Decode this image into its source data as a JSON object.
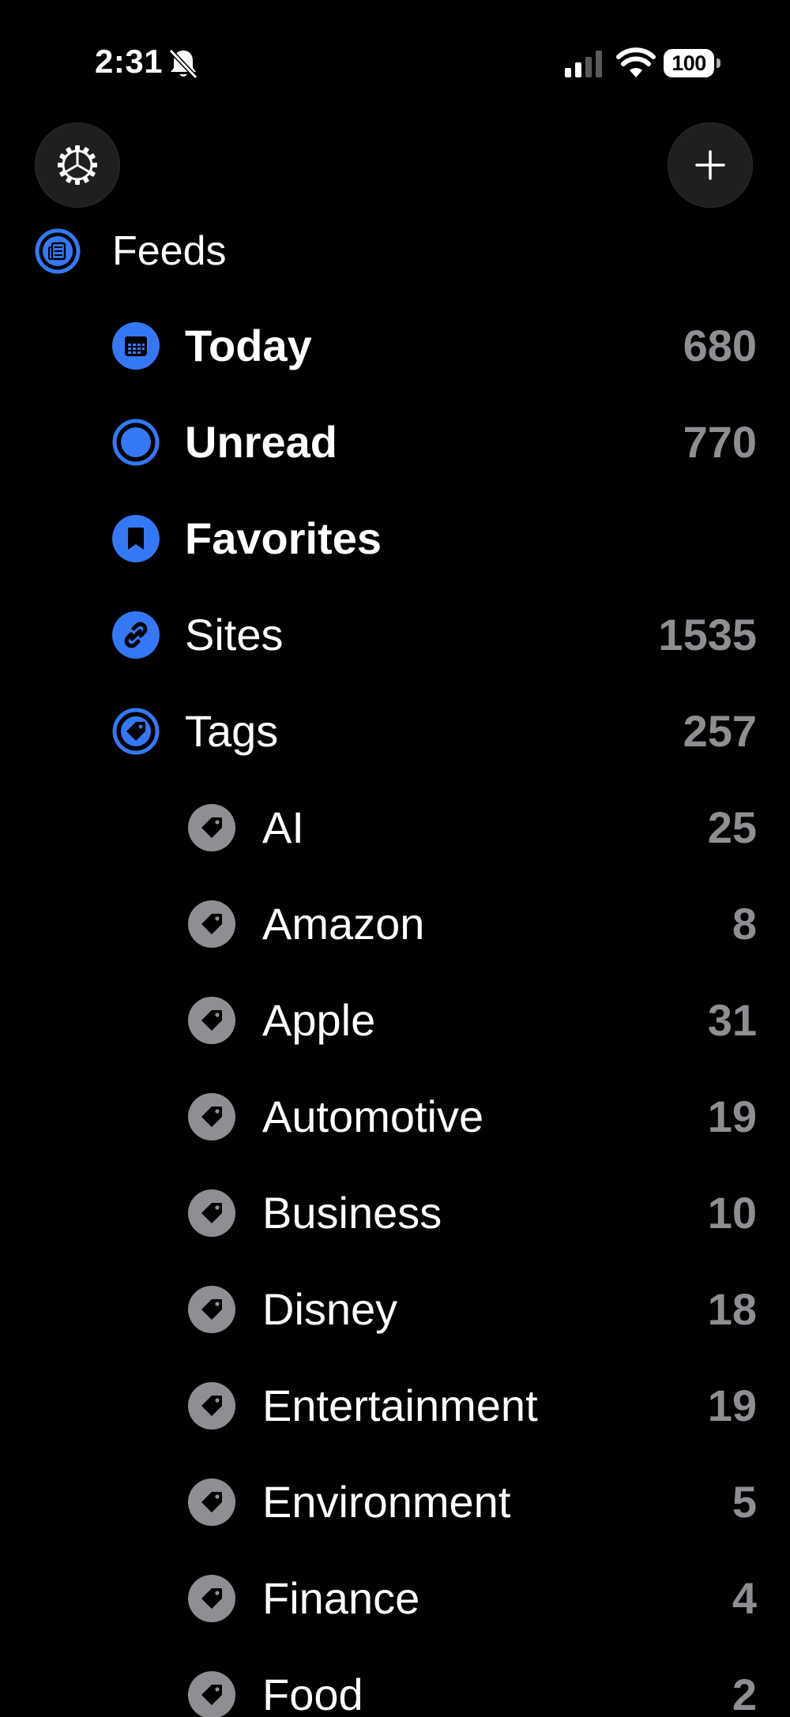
{
  "status_bar": {
    "time": "2:31",
    "battery": "100"
  },
  "colors": {
    "accent": "#3478f6",
    "tag_gray": "#8e8e93",
    "count_gray": "#8e8e93",
    "background": "#000000"
  },
  "header": {
    "settings_icon": "gear-icon",
    "add_icon": "plus-icon"
  },
  "feeds": {
    "label": "Feeds",
    "icon": "newspaper-icon"
  },
  "main_items": [
    {
      "label": "Today",
      "count": "680",
      "icon": "calendar-icon"
    },
    {
      "label": "Unread",
      "count": "770",
      "icon": "circle-icon"
    },
    {
      "label": "Favorites",
      "count": "",
      "icon": "bookmark-icon"
    },
    {
      "label": "Sites",
      "count": "1535",
      "icon": "link-icon"
    },
    {
      "label": "Tags",
      "count": "257",
      "icon": "tag-icon"
    }
  ],
  "tags": [
    {
      "label": "AI",
      "count": "25"
    },
    {
      "label": "Amazon",
      "count": "8"
    },
    {
      "label": "Apple",
      "count": "31"
    },
    {
      "label": "Automotive",
      "count": "19"
    },
    {
      "label": "Business",
      "count": "10"
    },
    {
      "label": "Disney",
      "count": "18"
    },
    {
      "label": "Entertainment",
      "count": "19"
    },
    {
      "label": "Environment",
      "count": "5"
    },
    {
      "label": "Finance",
      "count": "4"
    },
    {
      "label": "Food",
      "count": "2"
    }
  ]
}
